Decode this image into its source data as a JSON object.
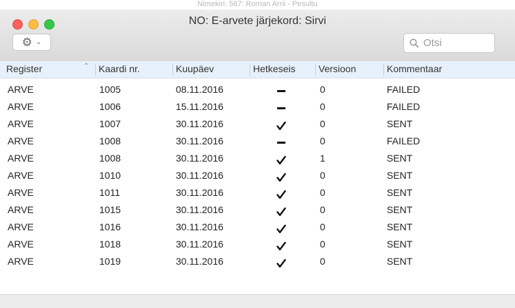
{
  "window": {
    "title": "NO: E-arvete järjekord: Sirvi",
    "background_title": "Nimekiri: 567: Roman Arrii - Pesultu"
  },
  "toolbar": {
    "gear_icon": "gear-icon",
    "search_placeholder": "Otsi"
  },
  "table": {
    "columns": [
      "Register",
      "Kaardi nr.",
      "Kuupäev",
      "Hetkeseis",
      "Versioon",
      "Kommentaar"
    ],
    "sorted_column": "Register",
    "rows": [
      {
        "register": "ARVE",
        "kaardi": "1005",
        "kuupaev": "08.11.2016",
        "hetkeseis": "dash",
        "versioon": "0",
        "kommentaar": "FAILED"
      },
      {
        "register": "ARVE",
        "kaardi": "1006",
        "kuupaev": "15.11.2016",
        "hetkeseis": "dash",
        "versioon": "0",
        "kommentaar": "FAILED"
      },
      {
        "register": "ARVE",
        "kaardi": "1007",
        "kuupaev": "30.11.2016",
        "hetkeseis": "check",
        "versioon": "0",
        "kommentaar": "SENT"
      },
      {
        "register": "ARVE",
        "kaardi": "1008",
        "kuupaev": "30.11.2016",
        "hetkeseis": "dash",
        "versioon": "0",
        "kommentaar": "FAILED"
      },
      {
        "register": "ARVE",
        "kaardi": "1008",
        "kuupaev": "30.11.2016",
        "hetkeseis": "check",
        "versioon": "1",
        "kommentaar": "SENT"
      },
      {
        "register": "ARVE",
        "kaardi": "1010",
        "kuupaev": "30.11.2016",
        "hetkeseis": "check",
        "versioon": "0",
        "kommentaar": "SENT"
      },
      {
        "register": "ARVE",
        "kaardi": "1011",
        "kuupaev": "30.11.2016",
        "hetkeseis": "check",
        "versioon": "0",
        "kommentaar": "SENT"
      },
      {
        "register": "ARVE",
        "kaardi": "1015",
        "kuupaev": "30.11.2016",
        "hetkeseis": "check",
        "versioon": "0",
        "kommentaar": "SENT"
      },
      {
        "register": "ARVE",
        "kaardi": "1016",
        "kuupaev": "30.11.2016",
        "hetkeseis": "check",
        "versioon": "0",
        "kommentaar": "SENT"
      },
      {
        "register": "ARVE",
        "kaardi": "1018",
        "kuupaev": "30.11.2016",
        "hetkeseis": "check",
        "versioon": "0",
        "kommentaar": "SENT"
      },
      {
        "register": "ARVE",
        "kaardi": "1019",
        "kuupaev": "30.11.2016",
        "hetkeseis": "check",
        "versioon": "0",
        "kommentaar": "SENT"
      }
    ]
  }
}
